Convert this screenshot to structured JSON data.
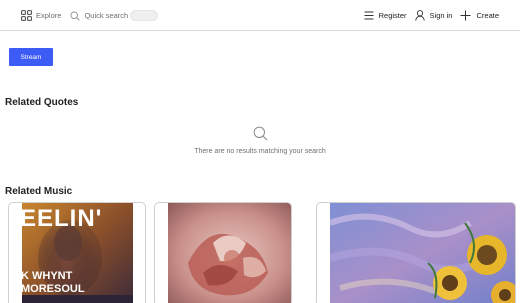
{
  "nav": {
    "explore_label": "Explore",
    "search_label": "Quick search",
    "register_label": "Register",
    "signin_label": "Sign in",
    "create_label": "Create"
  },
  "actions": {
    "stream_label": "Stream"
  },
  "related_quotes": {
    "title": "Related Quotes",
    "empty_message": "There are no results matching your search"
  },
  "related_music": {
    "title": "Related Music",
    "items": [
      {
        "art_text_top": "EELIN'",
        "art_text_line1": "K WHYNT",
        "art_text_line2": "MORESOUL"
      },
      {
        "art_text_top": "",
        "art_text_line1": "",
        "art_text_line2": ""
      },
      {
        "art_text_top": "",
        "art_text_line1": "",
        "art_text_line2": ""
      }
    ]
  },
  "colors": {
    "accent": "#3c5cf5",
    "muted_text": "#6f6f6f",
    "border": "#d9d9d9"
  }
}
